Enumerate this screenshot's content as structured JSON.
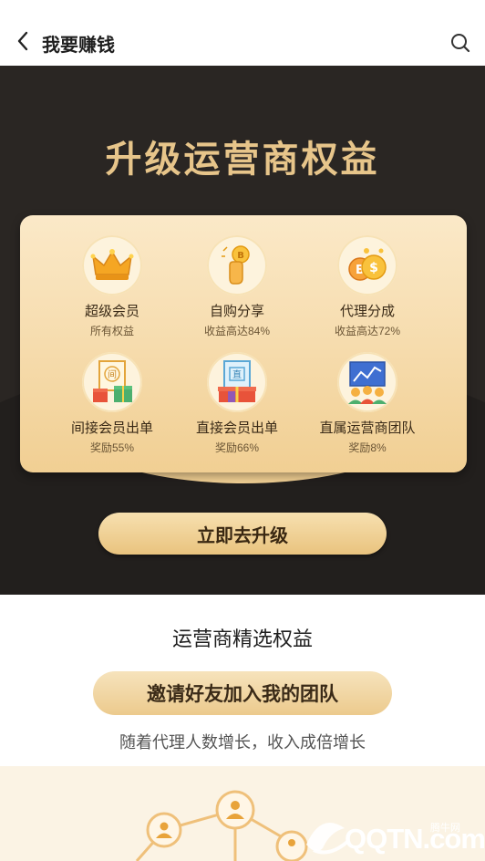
{
  "header": {
    "title": "我要赚钱",
    "back_icon": "chevron-left-icon",
    "search_icon": "search-icon"
  },
  "hero": {
    "title": "升级运营商权益",
    "benefits": [
      {
        "title": "超级会员",
        "subtitle": "所有权益",
        "icon": "crown-icon"
      },
      {
        "title": "自购分享",
        "subtitle": "收益高达84%",
        "icon": "coin-hand-icon"
      },
      {
        "title": "代理分成",
        "subtitle": "收益高达72%",
        "icon": "coins-icon"
      },
      {
        "title": "间接会员出单",
        "subtitle": "奖励55%",
        "icon": "indirect-gift-icon"
      },
      {
        "title": "直接会员出单",
        "subtitle": "奖励66%",
        "icon": "direct-gift-icon"
      },
      {
        "title": "直属运营商团队",
        "subtitle": "奖励8%",
        "icon": "team-chart-icon"
      }
    ],
    "indirect_char": "间",
    "direct_char": "直",
    "upgrade_label": "立即去升级"
  },
  "selected": {
    "section_title": "运营商精选权益",
    "invite_label": "邀请好友加入我的团队",
    "invite_desc": "随着代理人数增长，收入成倍增长"
  },
  "watermark": {
    "brand": "QQTN.com",
    "tag": "腾牛网"
  },
  "colors": {
    "hero_bg": "#2a2623",
    "gold_text": "#e7c58a",
    "card_bg": "#fbe9c8",
    "pill_bg": "#ecca8d"
  }
}
